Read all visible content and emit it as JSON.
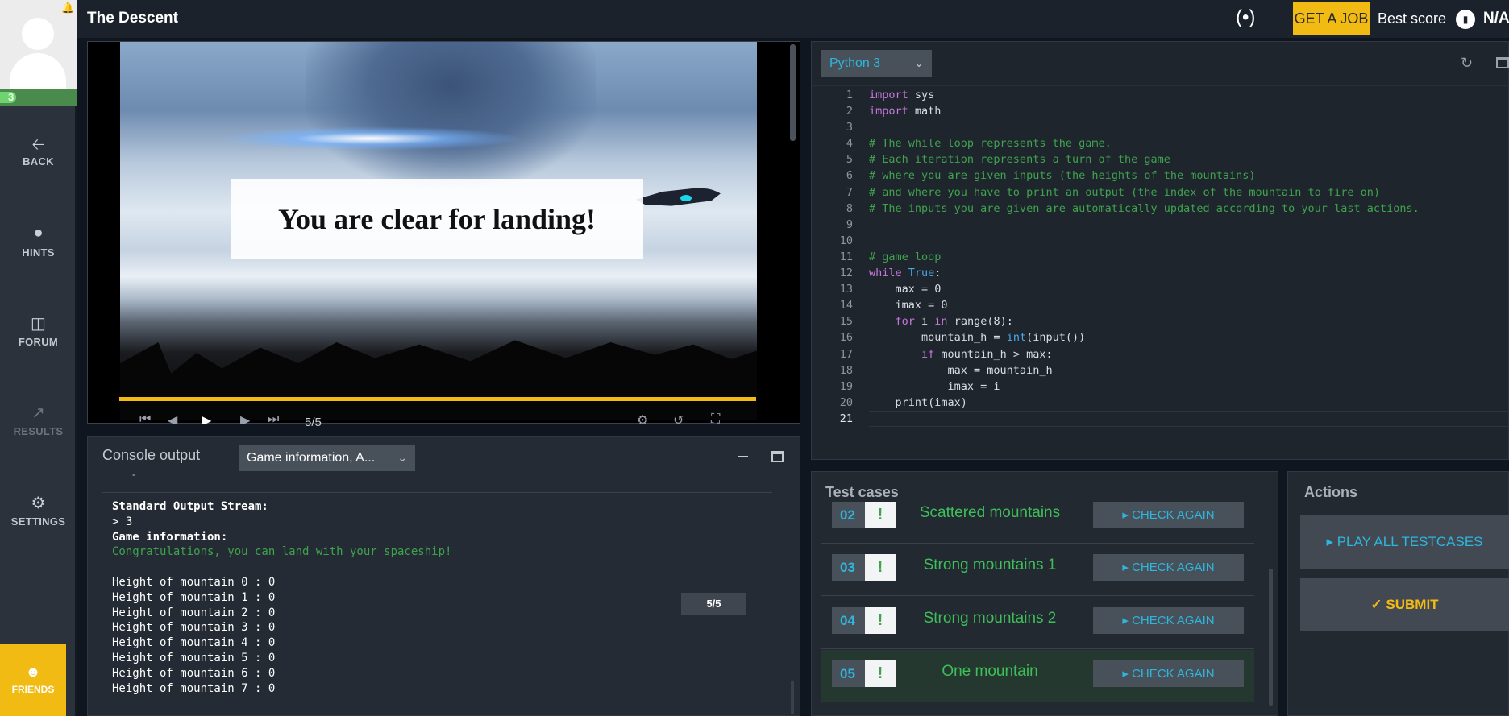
{
  "app": {
    "title": "The Descent"
  },
  "sidebar": {
    "level": "3",
    "items": [
      {
        "label": "BACK",
        "icon": "arrow-left-icon"
      },
      {
        "label": "HINTS",
        "icon": "bulb-icon"
      },
      {
        "label": "FORUM",
        "icon": "forum-icon"
      },
      {
        "label": "RESULTS",
        "icon": "chart-line-icon"
      },
      {
        "label": "SETTINGS",
        "icon": "gear-icon"
      }
    ],
    "friends_label": "FRIENDS"
  },
  "header": {
    "get_job": "GET A JOB",
    "best_score_label": "Best score",
    "best_score_value": "N/A"
  },
  "viewer": {
    "banner": "You are clear for landing!",
    "frame": "5/5",
    "progress": 1.0
  },
  "console": {
    "title": "Console output",
    "dash": "-",
    "filter": "Game information, A...",
    "frame_badge": "5/5",
    "stdout_header": "Standard Output Stream:",
    "stdout_line": "> 3",
    "info_header": "Game information:",
    "info_message": "Congratulations, you can land with your spaceship!",
    "heights": [
      "Height of mountain 0 : 0",
      "Height of mountain 1 : 0",
      "Height of mountain 2 : 0",
      "Height of mountain 3 : 0",
      "Height of mountain 4 : 0",
      "Height of mountain 5 : 0",
      "Height of mountain 6 : 0",
      "Height of mountain 7 : 0"
    ]
  },
  "editor": {
    "language": "Python 3",
    "line_count": 21
  },
  "tests": {
    "title": "Test cases",
    "check_label": "CHECK AGAIN",
    "items": [
      {
        "num": "02",
        "name": "Scattered mountains",
        "status": "!"
      },
      {
        "num": "03",
        "name": "Strong mountains 1",
        "status": "!"
      },
      {
        "num": "04",
        "name": "Strong mountains 2",
        "status": "!"
      },
      {
        "num": "05",
        "name": "One mountain",
        "status": "!"
      }
    ]
  },
  "actions": {
    "title": "Actions",
    "play_all": "PLAY ALL TESTCASES",
    "submit": "SUBMIT"
  },
  "colors": {
    "accent": "#f2bb13",
    "link": "#2eb6dd",
    "success": "#3fbf5a",
    "background": "#101620"
  }
}
